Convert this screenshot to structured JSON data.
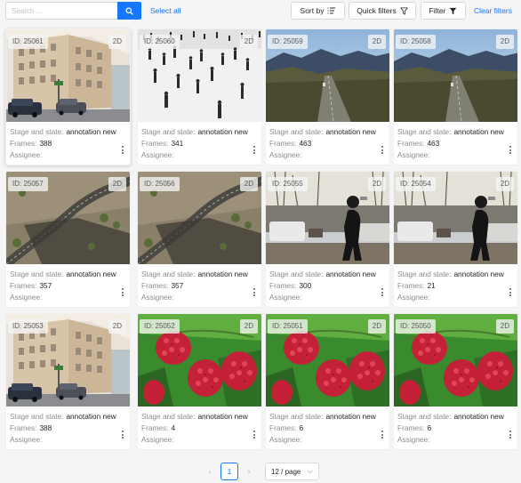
{
  "toolbar": {
    "search_placeholder": "Search ...",
    "select_all": "Select all",
    "sort_by": "Sort by",
    "quick_filters": "Quick filters",
    "filter": "Filter",
    "clear_filters": "Clear filters"
  },
  "labels": {
    "stage": "Stage and state",
    "frames": "Frames",
    "assignee": "Assignee",
    "sep": ":"
  },
  "cards": [
    {
      "id": "ID: 25061",
      "dim": "2D",
      "stage": "annotation new",
      "frames": "388",
      "img": "building"
    },
    {
      "id": "ID: 25060",
      "dim": "2D",
      "stage": "annotation new",
      "frames": "341",
      "img": "crowd"
    },
    {
      "id": "ID: 25059",
      "dim": "2D",
      "stage": "annotation new",
      "frames": "463",
      "img": "mountain"
    },
    {
      "id": "ID: 25058",
      "dim": "2D",
      "stage": "annotation new",
      "frames": "463",
      "img": "mountain"
    },
    {
      "id": "ID: 25057",
      "dim": "2D",
      "stage": "annotation new",
      "frames": "357",
      "img": "road"
    },
    {
      "id": "ID: 25056",
      "dim": "2D",
      "stage": "annotation new",
      "frames": "357",
      "img": "road"
    },
    {
      "id": "ID: 25055",
      "dim": "2D",
      "stage": "annotation new",
      "frames": "300",
      "img": "walker"
    },
    {
      "id": "ID: 25054",
      "dim": "2D",
      "stage": "annotation new",
      "frames": "21",
      "img": "walker"
    },
    {
      "id": "ID: 25053",
      "dim": "2D",
      "stage": "annotation new",
      "frames": "388",
      "img": "building"
    },
    {
      "id": "ID: 25052",
      "dim": "2D",
      "stage": "annotation new",
      "frames": "4",
      "img": "raspberry"
    },
    {
      "id": "ID: 25051",
      "dim": "2D",
      "stage": "annotation new",
      "frames": "6",
      "img": "raspberry"
    },
    {
      "id": "ID: 25050",
      "dim": "2D",
      "stage": "annotation new",
      "frames": "6",
      "img": "raspberry"
    }
  ],
  "pagination": {
    "current": "1",
    "page_size": "12 / page"
  },
  "colors": {
    "primary": "#1677ff",
    "card_bg": "#ffffff",
    "page_bg": "#f5f5f5"
  }
}
